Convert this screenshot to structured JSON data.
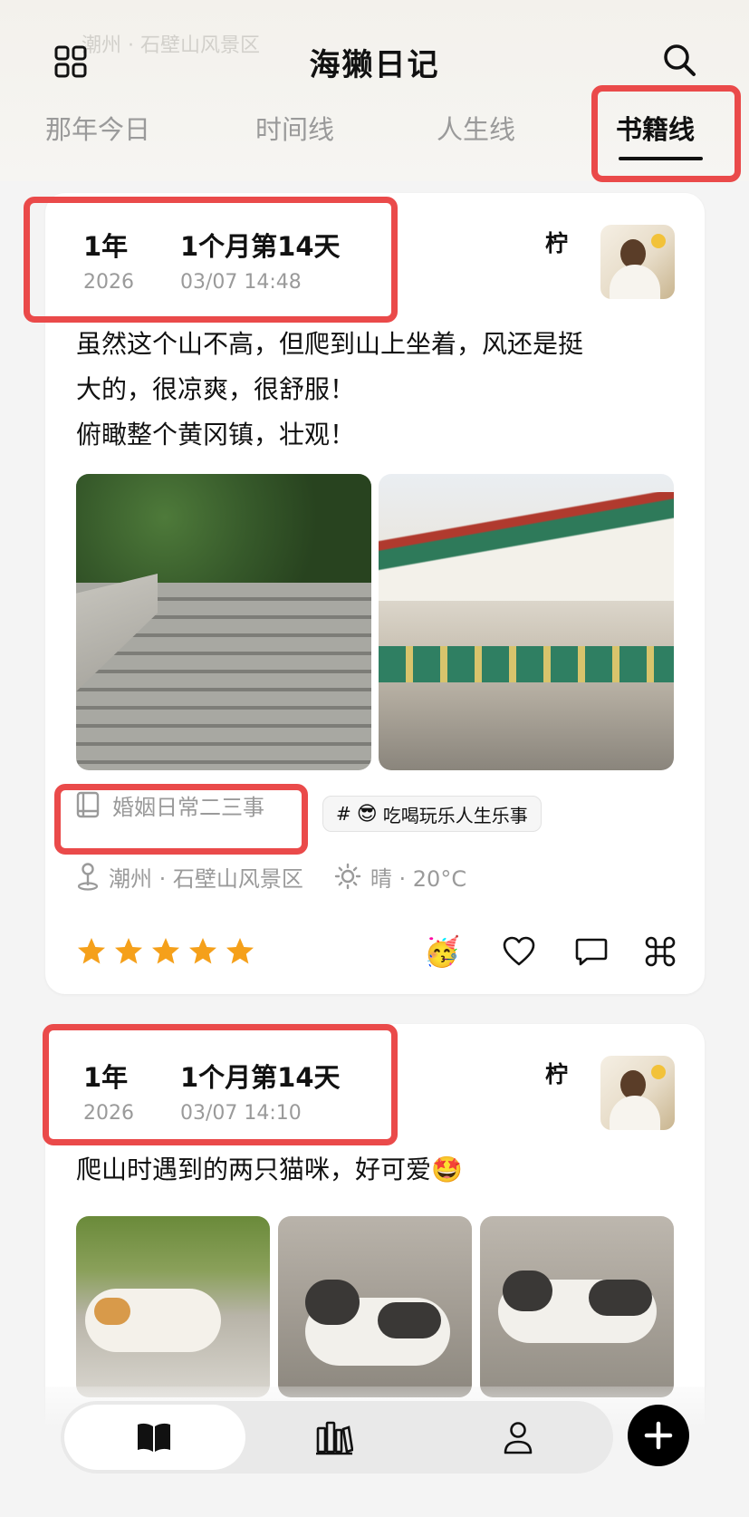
{
  "header": {
    "title": "海獭日记",
    "ghost_text": "潮州 · 石壁山风景区",
    "tabs": [
      "那年今日",
      "时间线",
      "人生线",
      "书籍线"
    ],
    "active_tab_index": 3
  },
  "cards": [
    {
      "year_label": "1年",
      "year": "2026",
      "elapsed": "1个月第14天",
      "datetime": "03/07 14:48",
      "author": "柠",
      "text_lines": [
        "虽然这个山不高，但爬到山上坐着，风还是挺",
        "大的，很凉爽，很舒服！",
        "俯瞰整个黄冈镇，壮观！"
      ],
      "book_tag": "婚姻日常二三事",
      "topic_tag": {
        "hash": "#",
        "emoji": "😎",
        "label": "吃喝玩乐人生乐事"
      },
      "location": "潮州 · 石壁山风景区",
      "weather": "晴 · 20°C",
      "rating": 5,
      "reaction_emoji": "🥳"
    },
    {
      "year_label": "1年",
      "year": "2026",
      "elapsed": "1个月第14天",
      "datetime": "03/07 14:10",
      "author": "柠",
      "text_lines": [
        "爬山时遇到的两只猫咪，好可爱🤩"
      ]
    }
  ],
  "icons": [
    "grid-icon",
    "search-icon",
    "book-icon",
    "location-pin-icon",
    "sun-icon",
    "star-icon",
    "heart-icon",
    "comment-icon",
    "command-icon",
    "open-book-icon",
    "library-icon",
    "person-icon",
    "plus-icon"
  ],
  "colors": {
    "highlight": "#ea4a4a",
    "star": "#f5a01a",
    "accent": "#111111"
  }
}
